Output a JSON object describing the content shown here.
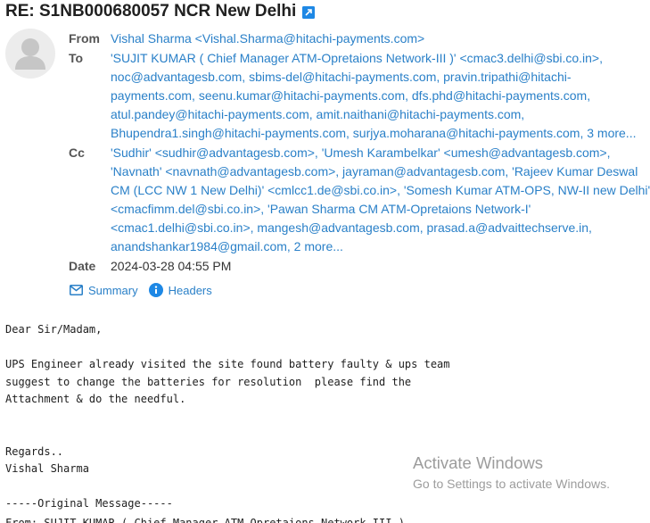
{
  "message": {
    "subject": "RE: S1NB000680057 NCR New Delhi",
    "popout_icon": "popout-icon"
  },
  "header": {
    "from_label": "From",
    "from_value": "Vishal Sharma <Vishal.Sharma@hitachi-payments.com>",
    "to_label": "To",
    "to_lines": [
      "'SUJIT KUMAR ( Chief Manager ATM-Opretaions Network-III )' <cmac3.delhi@sbi.co.in>,",
      "noc@advantagesb.com, sbims-del@hitachi-payments.com, pravin.tripathi@hitachi-",
      "payments.com, seenu.kumar@hitachi-payments.com, dfs.phd@hitachi-payments.com,",
      "atul.pandey@hitachi-payments.com, amit.naithani@hitachi-payments.com,",
      "Bhupendra1.singh@hitachi-payments.com, surjya.moharana@hitachi-payments.com, 3 more..."
    ],
    "cc_label": "Cc",
    "cc_lines": [
      "'Sudhir' <sudhir@advantagesb.com>, 'Umesh Karambelkar' <umesh@advantagesb.com>,",
      "'Navnath' <navnath@advantagesb.com>, jayraman@advantagesb.com, 'Rajeev Kumar Deswal",
      "CM (LCC NW 1 New Delhi)' <cmlcc1.de@sbi.co.in>, 'Somesh Kumar ATM-OPS, NW-II new Delhi'",
      "<cmacfimm.del@sbi.co.in>, 'Pawan Sharma CM ATM-Opretaions Network-I'",
      "<cmac1.delhi@sbi.co.in>, mangesh@advantagesb.com, prasad.a@advaittechserve.in,",
      "anandshankar1984@gmail.com, 2 more..."
    ],
    "date_label": "Date",
    "date_value": "2024-03-28 04:55 PM"
  },
  "actions": {
    "summary_label": "Summary",
    "headers_label": "Headers"
  },
  "body": {
    "text": "Dear Sir/Madam,\n\nUPS Engineer already visited the site found battery faulty & ups team\nsuggest to change the batteries for resolution  please find the\nAttachment & do the needful.\n\n\nRegards..\nVishal Sharma\n\n-----Original Message-----",
    "cut_line": "From: SUJIT KUMAR ( Chief Manager ATM-Opretaions Network-III )"
  },
  "watermark": {
    "title": "Activate Windows",
    "subtitle": "Go to Settings to activate Windows."
  },
  "colors": {
    "link": "#2a80c8",
    "label": "#555555",
    "popout_icon_bg": "#1e88e5",
    "headers_icon_bg": "#1e88e5",
    "watermark": "#9c9c9c"
  }
}
